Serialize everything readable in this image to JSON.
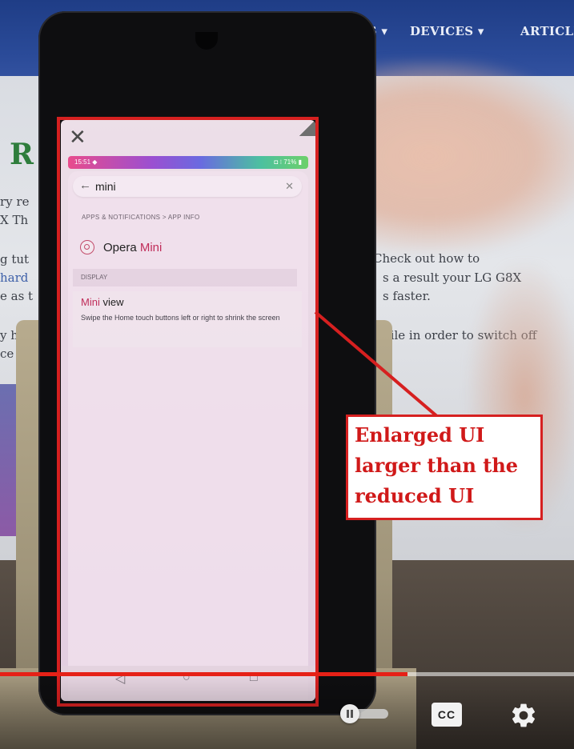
{
  "website": {
    "nav_items": [
      "ES ▾",
      "DEVICES ▾",
      "ARTICLE"
    ],
    "title_fragment": "R",
    "text_left": [
      "ry re",
      "X Th",
      "g tut",
      "hard",
      "e as t",
      "y h",
      "ce"
    ],
    "text_right": [
      "Check out how to",
      "s a result your LG G8X",
      "s faster.",
      "hile in order to switch off"
    ]
  },
  "phone": {
    "close_icon_glyph": "✕",
    "status_bar": {
      "time": "15:51 ◆",
      "icons": "◘ ⁝ 71% ▮"
    },
    "search": {
      "back_glyph": "←",
      "query": "mini",
      "clear_glyph": "✕"
    },
    "breadcrumb": "APPS & NOTIFICATIONS > APP INFO",
    "result": {
      "title_prefix": "Opera ",
      "title_match": "Mini"
    },
    "section_label": "DISPLAY",
    "mini_view": {
      "title_match": "Mini",
      "title_suffix": " view",
      "description": "Swipe the Home touch buttons left or right to shrink the screen"
    },
    "nav_buttons": {
      "back": "◁",
      "home": "○",
      "recents": "□"
    }
  },
  "annotation": {
    "text": "Enlarged UI\nlarger than the\nreduced UI",
    "color": "#d62020"
  },
  "player": {
    "progress_fraction": 0.71,
    "progress_color": "#e62117",
    "cc_label": "CC",
    "icons": [
      "autoplay-toggle-icon",
      "cc-icon",
      "gear-icon"
    ]
  }
}
